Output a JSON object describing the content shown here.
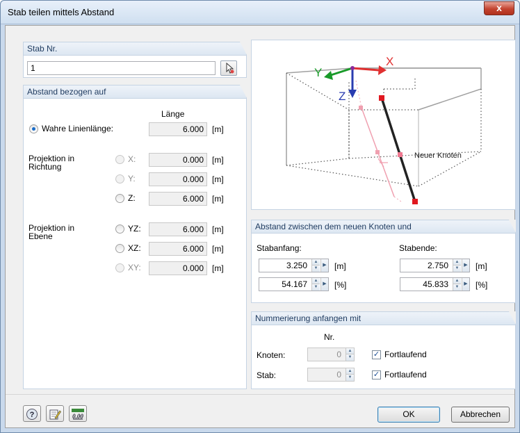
{
  "window": {
    "title": "Stab teilen mittels Abstand",
    "close_glyph": "x"
  },
  "stab": {
    "header": "Stab Nr.",
    "value": "1"
  },
  "abstand": {
    "header": "Abstand bezogen auf",
    "col_header": "Länge",
    "wahre": {
      "label": "Wahre Linienlänge:",
      "value": "6.000",
      "unit": "[m]"
    },
    "proj_richtung_label": [
      "Projektion in",
      "Richtung"
    ],
    "richtung": [
      {
        "label": "X:",
        "value": "0.000",
        "unit": "[m]"
      },
      {
        "label": "Y:",
        "value": "0.000",
        "unit": "[m]"
      },
      {
        "label": "Z:",
        "value": "6.000",
        "unit": "[m]"
      }
    ],
    "proj_ebene_label": [
      "Projektion in",
      "Ebene"
    ],
    "ebene": [
      {
        "label": "YZ:",
        "value": "6.000",
        "unit": "[m]"
      },
      {
        "label": "XZ:",
        "value": "6.000",
        "unit": "[m]"
      },
      {
        "label": "XY:",
        "value": "0.000",
        "unit": "[m]"
      }
    ]
  },
  "preview": {
    "axis_x": "X",
    "axis_y": "Y",
    "axis_z": "Z",
    "node_label": "Neuer Knoten",
    "colors": {
      "x_axis": "#e03030",
      "y_axis": "#1a9a2a",
      "z_axis": "#2a3cb0"
    }
  },
  "zwischen": {
    "header": "Abstand zwischen dem neuen Knoten und",
    "start_label": "Stabanfang:",
    "end_label": "Stabende:",
    "start_m": "3.250",
    "start_pct": "54.167",
    "end_m": "2.750",
    "end_pct": "45.833",
    "unit_m": "[m]",
    "unit_pct": "[%]"
  },
  "nummer": {
    "header": "Nummerierung anfangen mit",
    "col_header": "Nr.",
    "knoten_label": "Knoten:",
    "knoten_value": "0",
    "stab_label": "Stab:",
    "stab_value": "0",
    "fortlaufend": "Fortlaufend"
  },
  "footer": {
    "help_icon": "help-icon",
    "edit_icon": "edit-icon",
    "units_icon": "units-icon",
    "units_glyph": "0.00",
    "ok": "OK",
    "cancel": "Abbrechen"
  }
}
